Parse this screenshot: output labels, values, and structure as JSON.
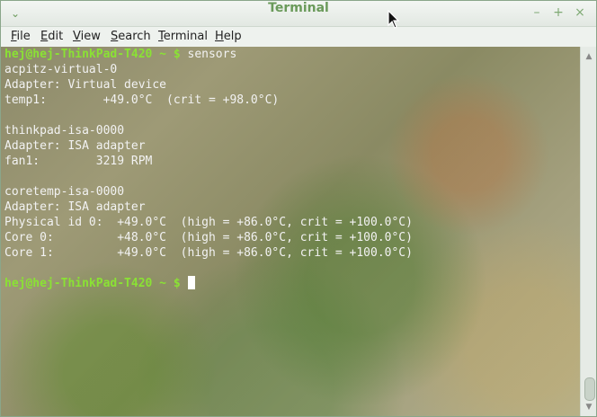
{
  "window": {
    "title": "Terminal",
    "controls": {
      "minimize": "–",
      "maximize": "+",
      "close": "×"
    }
  },
  "menubar": {
    "items": [
      {
        "underline": "F",
        "rest": "ile"
      },
      {
        "underline": "E",
        "rest": "dit"
      },
      {
        "underline": "V",
        "rest": "iew"
      },
      {
        "underline": "S",
        "rest": "earch"
      },
      {
        "underline": "T",
        "rest": "erminal"
      },
      {
        "underline": "H",
        "rest": "elp"
      }
    ]
  },
  "terminal": {
    "prompt": "hej@hej-ThinkPad-T420 ~ $",
    "command": " sensors",
    "output": [
      "acpitz-virtual-0",
      "Adapter: Virtual device",
      "temp1:        +49.0°C  (crit = +98.0°C)",
      "",
      "thinkpad-isa-0000",
      "Adapter: ISA adapter",
      "fan1:        3219 RPM",
      "",
      "coretemp-isa-0000",
      "Adapter: ISA adapter",
      "Physical id 0:  +49.0°C  (high = +86.0°C, crit = +100.0°C)",
      "Core 0:         +48.0°C  (high = +86.0°C, crit = +100.0°C)",
      "Core 1:         +49.0°C  (high = +86.0°C, crit = +100.0°C)",
      ""
    ],
    "prompt2": "hej@hej-ThinkPad-T420 ~ $"
  },
  "colors": {
    "prompt": "#8ae234",
    "text": "#f2f2f2",
    "title": "#6a9a5a"
  },
  "icons": {
    "window_menu": "chevron-down-icon",
    "pointer": "mouse-pointer-icon"
  }
}
